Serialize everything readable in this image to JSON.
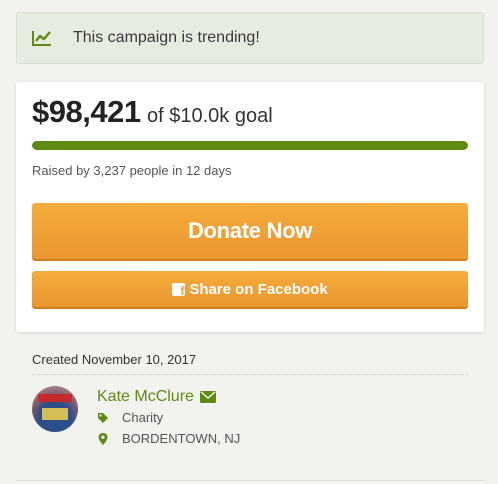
{
  "trending": {
    "text": "This campaign is trending!"
  },
  "funding": {
    "amount": "$98,421",
    "goal_text": "of $10.0k goal",
    "progress": 1.0,
    "raised_text": "Raised by 3,237 people in 12 days"
  },
  "buttons": {
    "donate_label": "Donate Now",
    "share_label": "Share on Facebook"
  },
  "created_text": "Created November 10, 2017",
  "organizer": {
    "name": "Kate McClure",
    "category": "Charity",
    "location": "BORDENTOWN, NJ"
  },
  "colors": {
    "accent_green": "#5f8a13",
    "button_orange": "#f0a03a"
  },
  "icons": [
    "trend-chart-icon",
    "facebook-icon",
    "envelope-icon",
    "tag-icon",
    "map-pin-icon"
  ]
}
